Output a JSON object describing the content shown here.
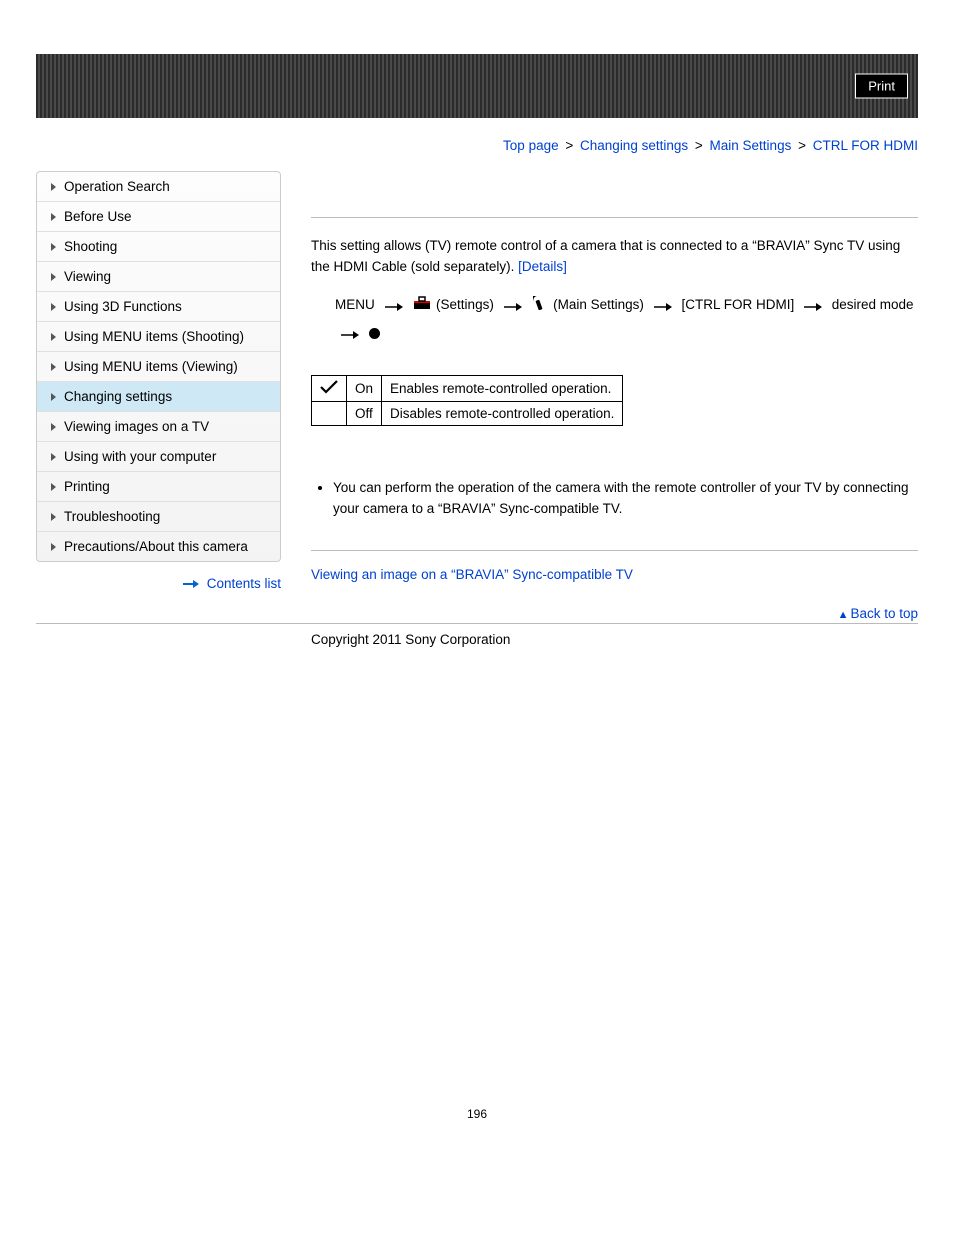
{
  "print_label": "Print",
  "breadcrumb": {
    "items": [
      "Top page",
      "Changing settings",
      "Main Settings"
    ],
    "current": "CTRL FOR HDMI",
    "sep": ">"
  },
  "sidebar": {
    "items": [
      {
        "label": "Operation Search",
        "active": false
      },
      {
        "label": "Before Use",
        "active": false
      },
      {
        "label": "Shooting",
        "active": false
      },
      {
        "label": "Viewing",
        "active": false
      },
      {
        "label": "Using 3D Functions",
        "active": false
      },
      {
        "label": "Using MENU items (Shooting)",
        "active": false
      },
      {
        "label": "Using MENU items (Viewing)",
        "active": false
      },
      {
        "label": "Changing settings",
        "active": true
      },
      {
        "label": "Viewing images on a TV",
        "active": false
      },
      {
        "label": "Using with your computer",
        "active": false
      },
      {
        "label": "Printing",
        "active": false
      },
      {
        "label": "Troubleshooting",
        "active": false
      },
      {
        "label": "Precautions/About this camera",
        "active": false
      }
    ]
  },
  "contents_list": "Contents list",
  "intro": {
    "text_a": "This setting allows (TV) remote control of a camera that is connected to a “BRAVIA” Sync TV using the HDMI Cable (sold separately). ",
    "details": "[Details]"
  },
  "menu_path": {
    "menu": "MENU",
    "settings": "(Settings)",
    "main_settings": "(Main Settings)",
    "ctrl": "[CTRL FOR HDMI]",
    "desired": "desired mode"
  },
  "table": {
    "rows": [
      {
        "check": true,
        "opt": "On",
        "desc": "Enables remote-controlled operation."
      },
      {
        "check": false,
        "opt": "Off",
        "desc": "Disables remote-controlled operation."
      }
    ]
  },
  "note": "You can perform the operation of the camera with the remote controller of your TV by connecting your camera to a “BRAVIA” Sync-compatible TV.",
  "related_link": "Viewing an image on a “BRAVIA” Sync-compatible TV",
  "back_to_top": "Back to top",
  "copyright": "Copyright 2011 Sony Corporation",
  "page_number": "196"
}
